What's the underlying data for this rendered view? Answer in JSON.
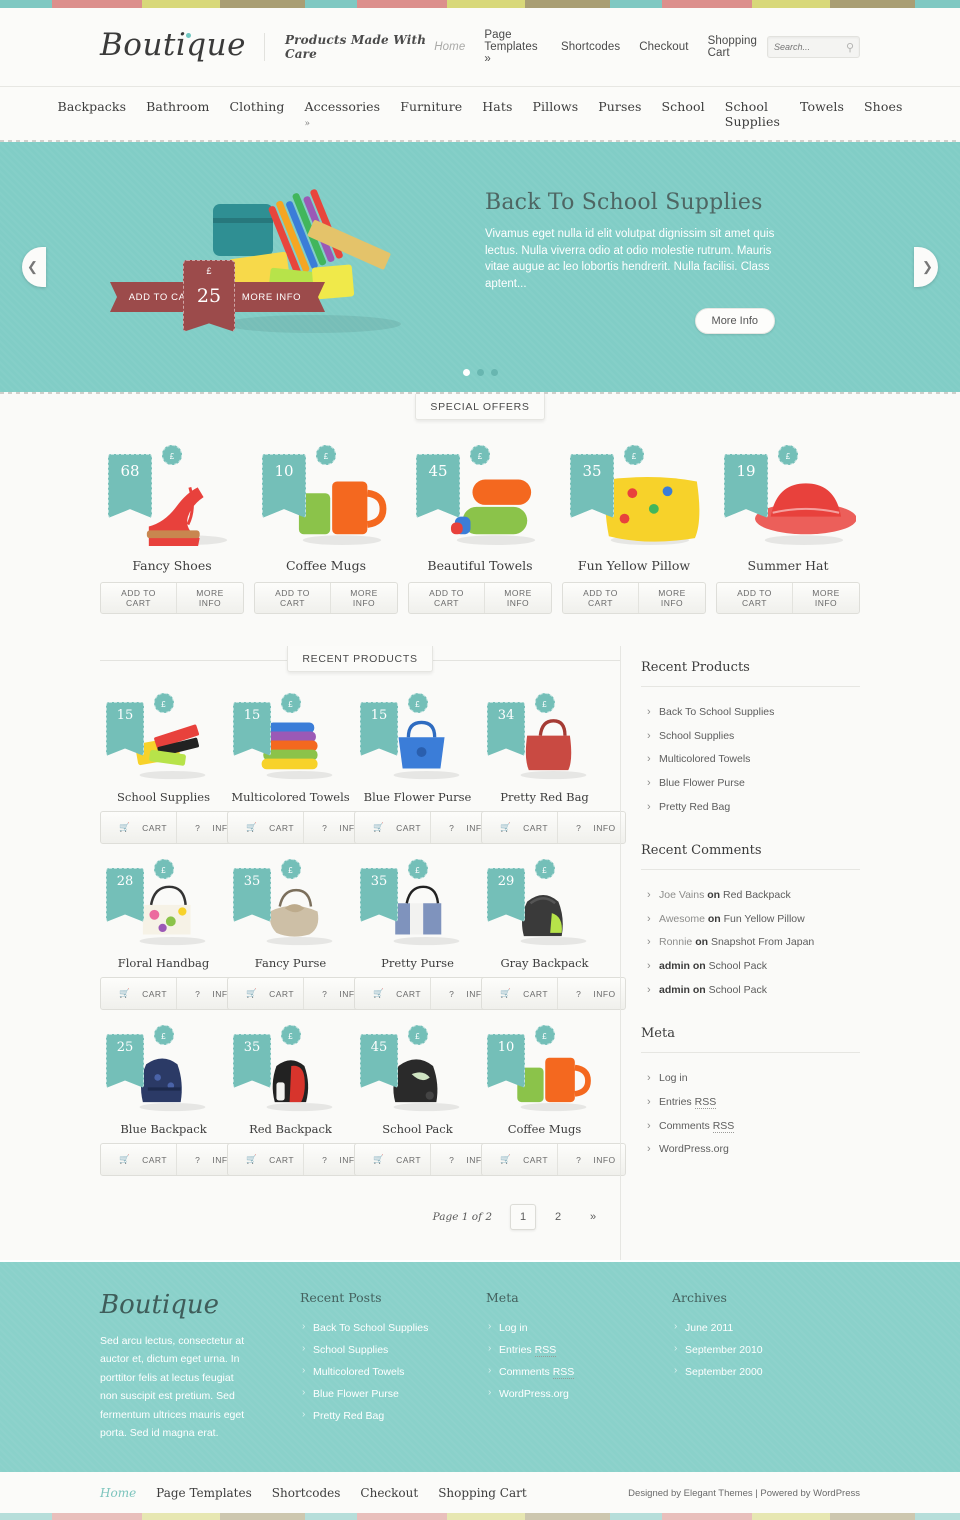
{
  "theme": {
    "teal": "#81cdc6",
    "footer_teal": "#8ad1ca",
    "ribbon_red": "#9c4b4b",
    "tag_teal": "#74bfb8",
    "strip_colors": [
      "#7fc8c2",
      "#dc8f8c",
      "#d8d87a",
      "#a99e74"
    ]
  },
  "header": {
    "logo": "Boutique",
    "tagline": "Products Made With Care",
    "nav": [
      {
        "label": "Home",
        "current": true
      },
      {
        "label": "Page Templates »",
        "current": false
      },
      {
        "label": "Shortcodes",
        "current": false
      },
      {
        "label": "Checkout",
        "current": false
      },
      {
        "label": "Shopping Cart",
        "current": false
      }
    ],
    "search": {
      "placeholder": "Search...",
      "value": "",
      "icon": "search-icon"
    }
  },
  "categories": [
    "Backpacks",
    "Bathroom",
    "Clothing",
    "Accessories »",
    "Furniture",
    "Hats",
    "Pillows",
    "Purses",
    "School",
    "School Supplies",
    "Towels",
    "Shoes"
  ],
  "slider": {
    "title": "Back To School Supplies",
    "description": "Vivamus eget nulla id elit volutpat dignissim sit amet quis lectus. Nulla viverra odio at odio molestie rutrum. Mauris vitae augue ac leo lobortis hendrerit. Nulla facilisi. Class aptent...",
    "more_info": "More Info",
    "add_to_cart": "ADD TO CART",
    "ribbon_more_info": "MORE INFO",
    "currency": "£",
    "price": "25",
    "prev_icon": "chevron-left-icon",
    "next_icon": "chevron-right-icon",
    "dots": 3,
    "active_dot": 0
  },
  "special_offers": {
    "heading": "SPECIAL OFFERS",
    "cart_label": "ADD TO CART",
    "info_label": "MORE INFO",
    "currency": "£",
    "items": [
      {
        "name": "Fancy Shoes",
        "price": "68"
      },
      {
        "name": "Coffee Mugs",
        "price": "10"
      },
      {
        "name": "Beautiful Towels",
        "price": "45"
      },
      {
        "name": "Fun Yellow Pillow",
        "price": "35"
      },
      {
        "name": "Summer Hat",
        "price": "19"
      }
    ]
  },
  "recent_products": {
    "heading": "RECENT PRODUCTS",
    "cart_label": "CART",
    "info_label": "INFO",
    "cart_icon": "shopping-cart-icon",
    "info_icon": "question-mark-icon",
    "currency": "£",
    "items": [
      {
        "name": "School Supplies",
        "price": "15"
      },
      {
        "name": "Multicolored Towels",
        "price": "15"
      },
      {
        "name": "Blue Flower Purse",
        "price": "15"
      },
      {
        "name": "Pretty Red Bag",
        "price": "34"
      },
      {
        "name": "Floral Handbag",
        "price": "28"
      },
      {
        "name": "Fancy Purse",
        "price": "35"
      },
      {
        "name": "Pretty Purse",
        "price": "35"
      },
      {
        "name": "Gray Backpack",
        "price": "29"
      },
      {
        "name": "Blue Backpack",
        "price": "25"
      },
      {
        "name": "Red Backpack",
        "price": "35"
      },
      {
        "name": "School Pack",
        "price": "45"
      },
      {
        "name": "Coffee Mugs",
        "price": "10"
      }
    ],
    "pagination": {
      "page_of": "Page 1 of 2",
      "pages": [
        "1",
        "2"
      ],
      "active": "1",
      "next": "»"
    }
  },
  "sidebar": {
    "recent_products": {
      "title": "Recent Products",
      "items": [
        "Back To School Supplies",
        "School Supplies",
        "Multicolored Towels",
        "Blue Flower Purse",
        "Pretty Red Bag"
      ]
    },
    "recent_comments": {
      "title": "Recent Comments",
      "separator": "on",
      "items": [
        {
          "author": "Joe Vains",
          "post": "Red Backpack",
          "admin": false
        },
        {
          "author": "Awesome",
          "post": "Fun Yellow Pillow",
          "admin": false
        },
        {
          "author": "Ronnie",
          "post": "Snapshot From Japan",
          "admin": false
        },
        {
          "author": "admin",
          "post": "School Pack",
          "admin": true
        },
        {
          "author": "admin",
          "post": "School Pack",
          "admin": true
        }
      ]
    },
    "meta": {
      "title": "Meta",
      "items": [
        "Log in",
        "Entries RSS",
        "Comments RSS",
        "WordPress.org"
      ]
    }
  },
  "footer": {
    "logo": "Boutique",
    "about": "Sed arcu lectus, consectetur at auctor et, dictum eget urna. In porttitor felis at lectus feugiat non suscipit est pretium. Sed fermentum ultrices mauris eget porta. Sed id magna erat.",
    "recent_posts": {
      "title": "Recent Posts",
      "items": [
        "Back To School Supplies",
        "School Supplies",
        "Multicolored Towels",
        "Blue Flower Purse",
        "Pretty Red Bag"
      ]
    },
    "meta": {
      "title": "Meta",
      "items": [
        "Log in",
        "Entries RSS",
        "Comments RSS",
        "WordPress.org"
      ]
    },
    "archives": {
      "title": "Archives",
      "items": [
        "June 2011",
        "September 2010",
        "September 2000"
      ]
    }
  },
  "bottom": {
    "nav": [
      {
        "label": "Home",
        "current": true
      },
      {
        "label": "Page Templates",
        "current": false
      },
      {
        "label": "Shortcodes",
        "current": false
      },
      {
        "label": "Checkout",
        "current": false
      },
      {
        "label": "Shopping Cart",
        "current": false
      }
    ],
    "credits": "Designed by Elegant Themes | Powered by WordPress"
  }
}
